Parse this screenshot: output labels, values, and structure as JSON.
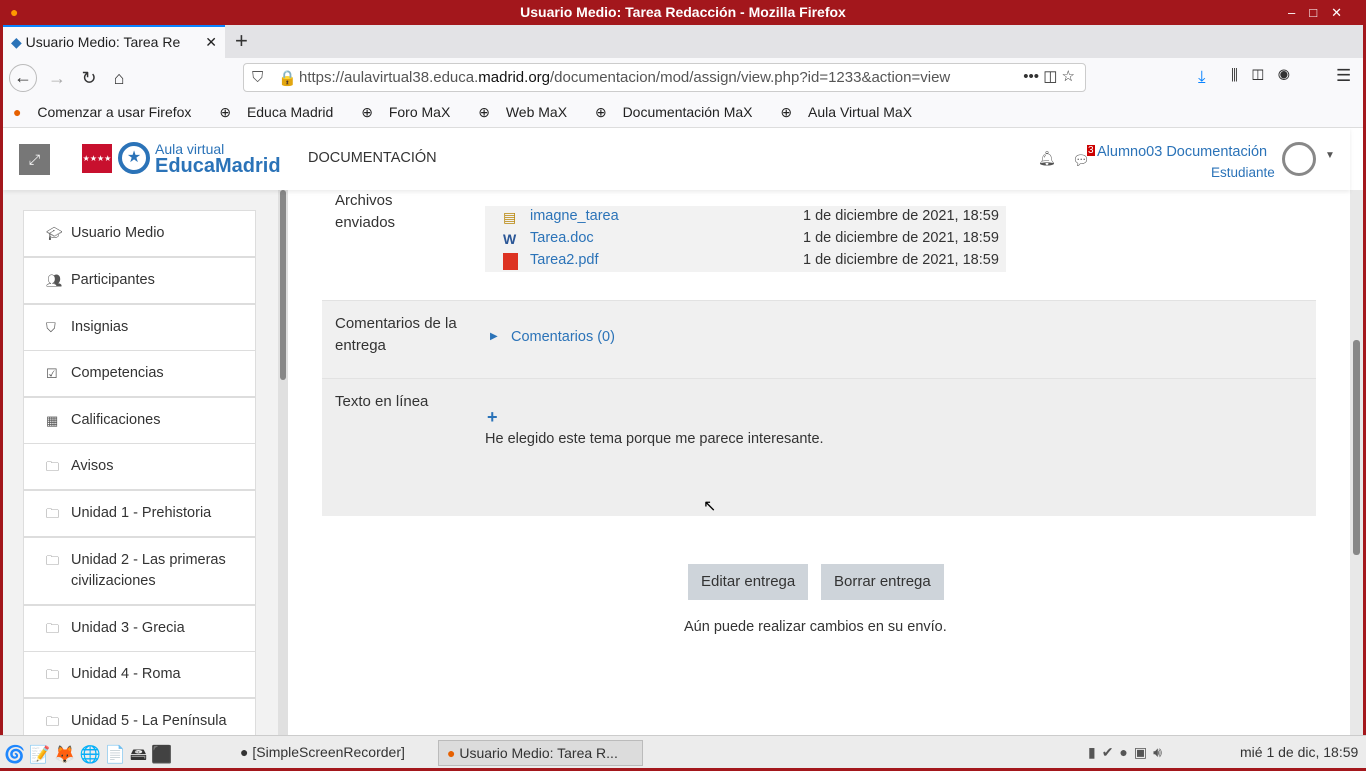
{
  "window": {
    "title": "Usuario Medio: Tarea Redacción - Mozilla Firefox"
  },
  "browser": {
    "tab_title": "Usuario Medio: Tarea Re",
    "url_prefix": "https://aulavirtual38.educa.",
    "url_domain": "madrid.org",
    "url_path": "/documentacion/mod/assign/view.php?id=1233&action=view",
    "bookmarks": [
      "Comenzar a usar Firefox",
      "Educa Madrid",
      "Foro MaX",
      "Web MaX",
      "Documentación MaX",
      "Aula Virtual MaX"
    ]
  },
  "header": {
    "logo_top": "Aula virtual",
    "logo_bottom": "EducaMadrid",
    "site": "DOCUMENTACIÓN",
    "badge": "3",
    "user": "Alumno03 Documentación",
    "role": "Estudiante"
  },
  "sidebar": {
    "items": [
      {
        "icon": "graduation-cap",
        "label": "Usuario Medio"
      },
      {
        "icon": "users",
        "label": "Participantes"
      },
      {
        "icon": "shield",
        "label": "Insignias"
      },
      {
        "icon": "check-square",
        "label": "Competencias"
      },
      {
        "icon": "table",
        "label": "Calificaciones"
      },
      {
        "icon": "folder",
        "label": "Avisos"
      },
      {
        "icon": "folder",
        "label": "Unidad 1 - Prehistoria"
      },
      {
        "icon": "folder",
        "label": "Unidad 2 - Las primeras civilizaciones"
      },
      {
        "icon": "folder",
        "label": "Unidad 3 - Grecia"
      },
      {
        "icon": "folder",
        "label": "Unidad 4 - Roma"
      },
      {
        "icon": "folder",
        "label": "Unidad 5 - La Península"
      }
    ]
  },
  "submission": {
    "files_label": "Archivos enviados",
    "files": [
      {
        "name": "imagne_tarea",
        "date": "1 de diciembre de 2021, 18:59"
      },
      {
        "name": "Tarea.doc",
        "date": "1 de diciembre de 2021, 18:59"
      },
      {
        "name": "Tarea2.pdf",
        "date": "1 de diciembre de 2021, 18:59"
      }
    ],
    "comments_label": "Comentarios de la entrega",
    "comments_link": "Comentarios (0)",
    "online_text_label": "Texto en línea",
    "online_text": "He elegido este tema porque me parece interesante.",
    "edit_button": "Editar entrega",
    "delete_button": "Borrar entrega",
    "note": "Aún puede realizar cambios en su envío."
  },
  "taskbar": {
    "apps": [
      "[SimpleScreenRecorder]",
      "Usuario Medio: Tarea R..."
    ],
    "clock": "mié 1 de dic, 18:59"
  }
}
